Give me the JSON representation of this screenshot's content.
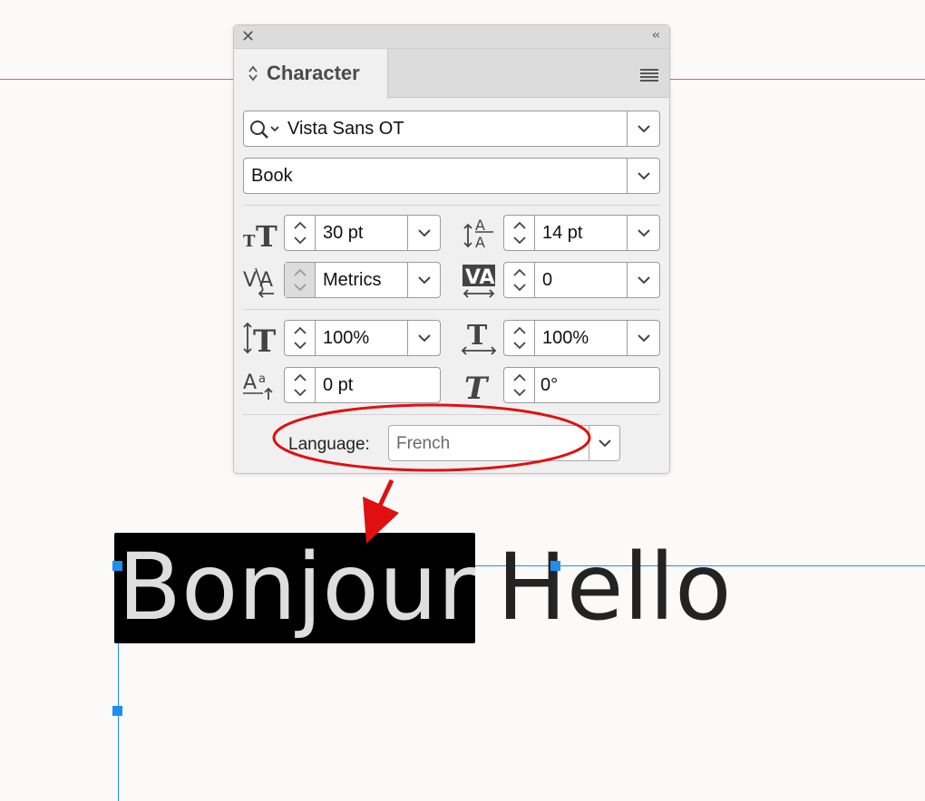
{
  "panel": {
    "title": "Character",
    "font_family": "Vista Sans OT",
    "font_style": "Book",
    "font_size": "30 pt",
    "leading": "14 pt",
    "kerning": "Metrics",
    "tracking": "0",
    "vertical_scale": "100%",
    "horizontal_scale": "100%",
    "baseline_shift": "0 pt",
    "skew": "0°",
    "language_label": "Language:",
    "language_value": "French"
  },
  "canvas": {
    "selected_word": "Bonjour",
    "plain_word": "Hello"
  },
  "colors": {
    "guide_magenta": "#d24fd6",
    "guide_blue": "#1e8ff0",
    "annotation_red": "#e01010",
    "selection_bg": "#000000"
  },
  "icons": [
    "close-icon",
    "collapse-icon",
    "panel-menu-icon",
    "search-icon",
    "chevron-down-icon",
    "font-size-icon",
    "leading-icon",
    "kerning-icon",
    "tracking-icon",
    "vertical-scale-icon",
    "horizontal-scale-icon",
    "baseline-shift-icon",
    "skew-icon"
  ]
}
